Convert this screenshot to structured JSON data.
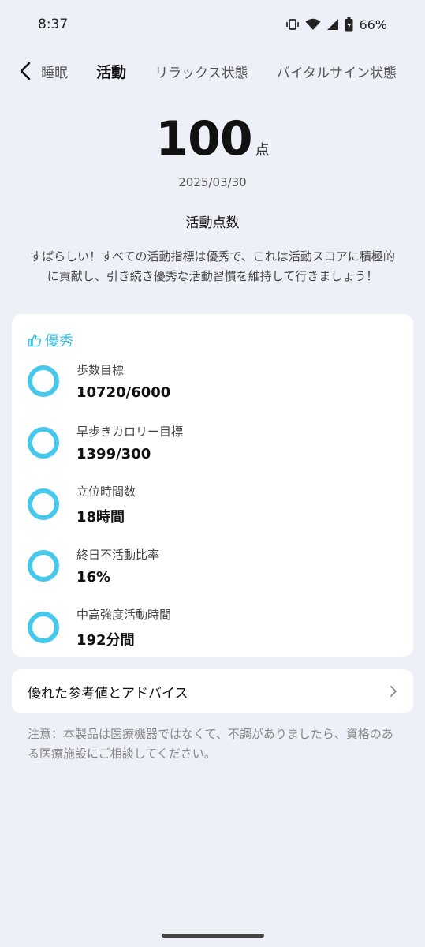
{
  "status": {
    "time": "8:37",
    "battery": "66%"
  },
  "tabs": [
    {
      "label": "睡眠"
    },
    {
      "label": "活動",
      "active": true
    },
    {
      "label": "リラックス状態"
    },
    {
      "label": "バイタルサイン状態"
    }
  ],
  "score": {
    "value": "100",
    "unit": "点",
    "date": "2025/03/30",
    "title": "活動点数",
    "description": "すばらしい！すべての活動指標は優秀で、これは活動スコアに積極的に貢献し、引き続き優秀な活動習慣を維持して行きましょう！"
  },
  "excellent": {
    "label": "優秀",
    "accent_color": "#3dbfe8",
    "metrics": [
      {
        "label": "歩数目標",
        "value": "10720/6000"
      },
      {
        "label": "早歩きカロリー目標",
        "value": "1399/300"
      },
      {
        "label": "立位時間数",
        "value": "18時間"
      },
      {
        "label": "終日不活動比率",
        "value": "16%"
      },
      {
        "label": "中高強度活動時間",
        "value": "192分間"
      }
    ]
  },
  "advice": {
    "label": "優れた参考値とアドバイス"
  },
  "note": "注意：本製品は医療機器ではなくて、不調がありましたら、資格のある医療施設にご相談してください。"
}
